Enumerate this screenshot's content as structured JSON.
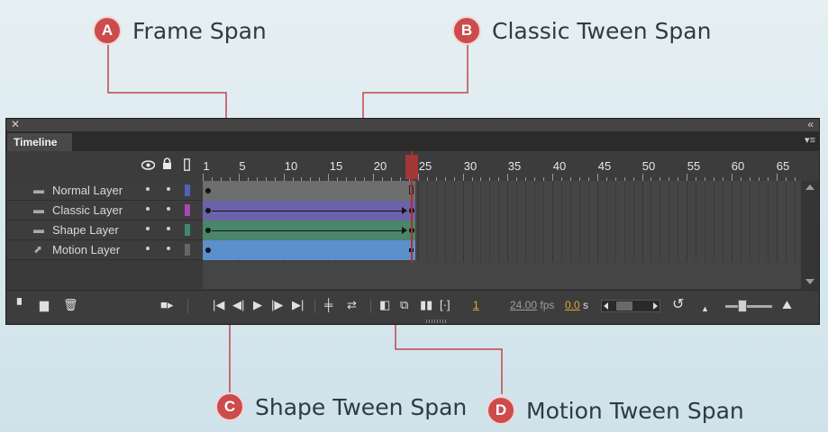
{
  "callouts": [
    {
      "letter": "A",
      "label": "Frame Span"
    },
    {
      "letter": "B",
      "label": "Classic Tween Span"
    },
    {
      "letter": "C",
      "label": "Shape Tween Span"
    },
    {
      "letter": "D",
      "label": "Motion Tween Span"
    }
  ],
  "panel": {
    "tab": "Timeline",
    "icons": {
      "close": "close-icon",
      "collapse": "collapse-icon",
      "menu": "panel-menu-icon"
    },
    "header_icons": [
      "eye-icon",
      "lock-icon",
      "outline-icon"
    ]
  },
  "ruler": {
    "labels": [
      "1",
      "5",
      "10",
      "15",
      "20",
      "25",
      "30",
      "35",
      "40",
      "45",
      "50",
      "55",
      "60",
      "65"
    ]
  },
  "layers": [
    {
      "name": "Normal Layer",
      "icon": "layer-icon",
      "color": "#4d63b4",
      "span_color": "#6e6e6e"
    },
    {
      "name": "Classic Layer",
      "icon": "layer-icon",
      "color": "#a649b0",
      "span_color": "#6a63a9"
    },
    {
      "name": "Shape Layer",
      "icon": "layer-icon",
      "color": "#3c8a6a",
      "span_color": "#4a8669"
    },
    {
      "name": "Motion Layer",
      "icon": "motion-layer-icon",
      "color": "#666666",
      "span_color": "#5b90cc"
    }
  ],
  "controls": {
    "current_frame": "1",
    "fps": "24.00",
    "fps_unit": "fps",
    "elapsed": "0.0",
    "elapsed_unit": "s"
  },
  "colors": {
    "callout_badge": "#cc4c4c",
    "callout_line": "#c0474a",
    "playhead": "#b12f2f",
    "panel_bg": "#3a3a3a"
  }
}
